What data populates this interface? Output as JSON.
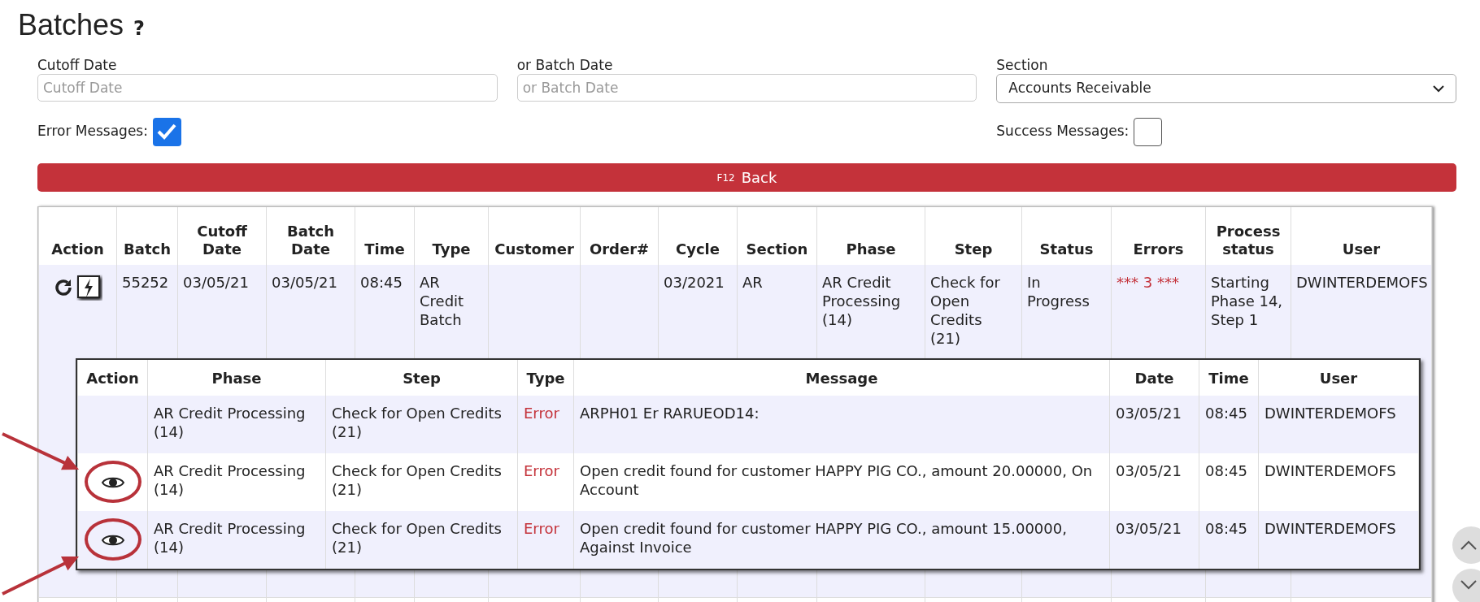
{
  "title": "Batches",
  "help": "?",
  "filters": {
    "cutoff_date": {
      "label": "Cutoff Date",
      "placeholder": "Cutoff Date"
    },
    "batch_date": {
      "label": "or Batch Date",
      "placeholder": "or Batch Date"
    },
    "section": {
      "label": "Section",
      "value": "Accounts Receivable"
    },
    "error_messages": {
      "label": "Error Messages:",
      "checked": true
    },
    "success_messages": {
      "label": "Success Messages:",
      "checked": false
    }
  },
  "back_button": {
    "key": "F12",
    "label": "Back"
  },
  "batches": {
    "columns": [
      "Action",
      "Batch",
      "Cutoff Date",
      "Batch Date",
      "Time",
      "Type",
      "Customer",
      "Order#",
      "Cycle",
      "Section",
      "Phase",
      "Step",
      "Status",
      "Errors",
      "Process status",
      "User"
    ],
    "rows": [
      {
        "batch": "55252",
        "cutoff_date": "03/05/21",
        "batch_date": "03/05/21",
        "time": "08:45",
        "type": "AR Credit Batch",
        "cycle": "03/2021",
        "section": "AR",
        "phase": "AR Credit Processing (14)",
        "step": "Check for Open Credits (21)",
        "status": "In Progress",
        "errors": "*** 3 ***",
        "process_status": "Starting Phase 14, Step 1",
        "user": "DWINTERDEMOFS"
      }
    ]
  },
  "messages": {
    "columns": [
      "Action",
      "Phase",
      "Step",
      "Type",
      "Message",
      "Date",
      "Time",
      "User"
    ],
    "rows": [
      {
        "view": false,
        "circled": false,
        "arrow_above": false,
        "arrow_below": false,
        "phase": "AR Credit Processing (14)",
        "step": "Check for Open Credits (21)",
        "type": "Error",
        "message": "ARPH01 Er RARUEOD14:",
        "date": "03/05/21",
        "time": "08:45",
        "user": "DWINTERDEMOFS"
      },
      {
        "view": true,
        "circled": true,
        "arrow_above": true,
        "arrow_below": false,
        "phase": "AR Credit Processing (14)",
        "step": "Check for Open Credits (21)",
        "type": "Error",
        "message": "Open credit found for customer HAPPY PIG CO., amount 20.00000, On Account",
        "date": "03/05/21",
        "time": "08:45",
        "user": "DWINTERDEMOFS"
      },
      {
        "view": true,
        "circled": true,
        "arrow_above": false,
        "arrow_below": true,
        "phase": "AR Credit Processing (14)",
        "step": "Check for Open Credits (21)",
        "type": "Error",
        "message": "Open credit found for customer HAPPY PIG CO., amount 15.00000, Against Invoice",
        "date": "03/05/21",
        "time": "08:45",
        "user": "DWINTERDEMOFS"
      }
    ]
  }
}
